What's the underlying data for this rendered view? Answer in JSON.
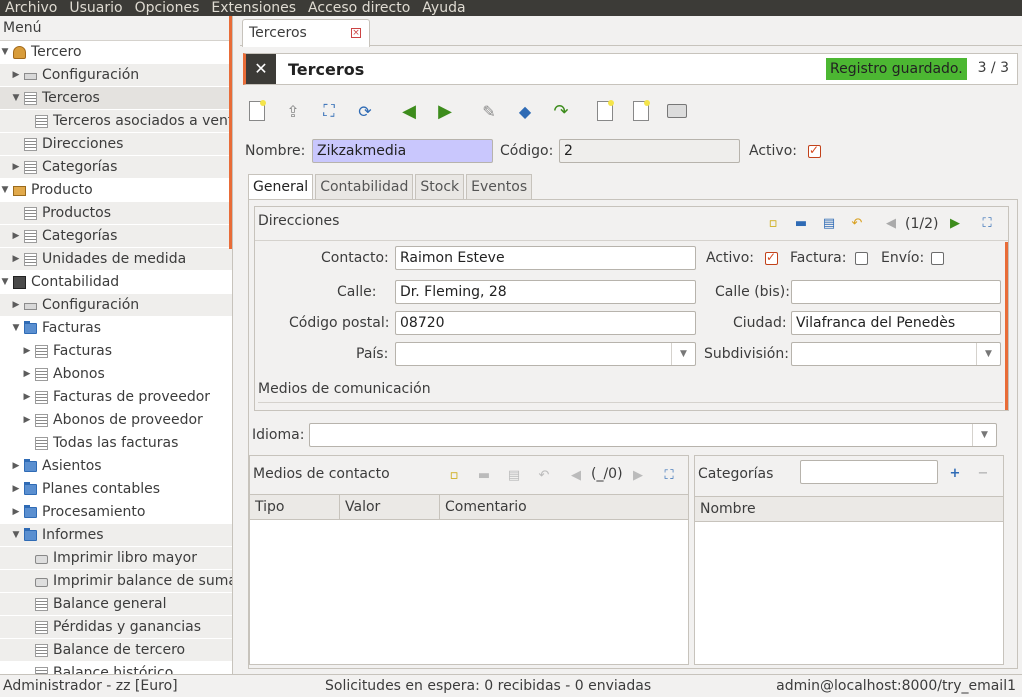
{
  "menubar": {
    "items": [
      "Archivo",
      "Usuario",
      "Opciones",
      "Extensiones",
      "Acceso directo",
      "Ayuda"
    ]
  },
  "sidebar": {
    "header": "Menú",
    "items": [
      {
        "label": "Tercero",
        "level": 0,
        "arrow": "open",
        "icon": "people-icon"
      },
      {
        "label": "Configuración",
        "level": 1,
        "arrow": "closed",
        "icon": "config-icon"
      },
      {
        "label": "Terceros",
        "level": 1,
        "arrow": "open",
        "icon": "document-icon",
        "selected": true
      },
      {
        "label": "Terceros asociados a venta",
        "level": 2,
        "arrow": "none",
        "icon": "document-icon"
      },
      {
        "label": "Direcciones",
        "level": 1,
        "arrow": "none",
        "icon": "document-icon"
      },
      {
        "label": "Categorías",
        "level": 1,
        "arrow": "closed",
        "icon": "document-icon"
      },
      {
        "label": "Producto",
        "level": 0,
        "arrow": "open",
        "icon": "box-icon"
      },
      {
        "label": "Productos",
        "level": 1,
        "arrow": "none",
        "icon": "document-icon"
      },
      {
        "label": "Categorías",
        "level": 1,
        "arrow": "closed",
        "icon": "document-icon"
      },
      {
        "label": "Unidades de medida",
        "level": 1,
        "arrow": "closed",
        "icon": "document-icon"
      },
      {
        "label": "Contabilidad",
        "level": 0,
        "arrow": "open",
        "icon": "calculator-icon"
      },
      {
        "label": "Configuración",
        "level": 1,
        "arrow": "closed",
        "icon": "config-icon"
      },
      {
        "label": "Facturas",
        "level": 1,
        "arrow": "open",
        "icon": "folder-icon"
      },
      {
        "label": "Facturas",
        "level": 2,
        "arrow": "closed",
        "icon": "document-icon"
      },
      {
        "label": "Abonos",
        "level": 2,
        "arrow": "closed",
        "icon": "document-icon"
      },
      {
        "label": "Facturas de proveedor",
        "level": 2,
        "arrow": "closed",
        "icon": "document-icon"
      },
      {
        "label": "Abonos de proveedor",
        "level": 2,
        "arrow": "closed",
        "icon": "document-icon"
      },
      {
        "label": "Todas las facturas",
        "level": 2,
        "arrow": "none",
        "icon": "document-icon"
      },
      {
        "label": "Asientos",
        "level": 1,
        "arrow": "closed",
        "icon": "folder-icon"
      },
      {
        "label": "Planes contables",
        "level": 1,
        "arrow": "closed",
        "icon": "folder-icon"
      },
      {
        "label": "Procesamiento",
        "level": 1,
        "arrow": "closed",
        "icon": "folder-icon"
      },
      {
        "label": "Informes",
        "level": 1,
        "arrow": "open",
        "icon": "folder-icon"
      },
      {
        "label": "Imprimir libro mayor",
        "level": 2,
        "arrow": "none",
        "icon": "printer-icon"
      },
      {
        "label": "Imprimir balance de sumas",
        "level": 2,
        "arrow": "none",
        "icon": "printer-icon"
      },
      {
        "label": "Balance general",
        "level": 2,
        "arrow": "none",
        "icon": "document-icon"
      },
      {
        "label": "Pérdidas y ganancias",
        "level": 2,
        "arrow": "none",
        "icon": "document-icon"
      },
      {
        "label": "Balance de tercero",
        "level": 2,
        "arrow": "none",
        "icon": "document-icon"
      },
      {
        "label": "Balance histórico",
        "level": 2,
        "arrow": "none",
        "icon": "document-icon"
      }
    ]
  },
  "tab": {
    "label": "Terceros"
  },
  "form": {
    "title": "Terceros",
    "status": "Registro guardado.",
    "record_pos": "3 / 3",
    "nombre_label": "Nombre:",
    "nombre_value": "Zikzakmedia",
    "codigo_label": "Código:",
    "codigo_value": "2",
    "activo_label": "Activo:"
  },
  "notebook": {
    "tabs": [
      "General",
      "Contabilidad",
      "Stock",
      "Eventos"
    ],
    "active": 0
  },
  "direcciones": {
    "header": "Direcciones",
    "pager": "(1/2)",
    "contacto_label": "Contacto:",
    "contacto_value": "Raimon Esteve",
    "activo_label": "Activo:",
    "factura_label": "Factura:",
    "envio_label": "Envío:",
    "calle_label": "Calle:",
    "calle_value": "Dr. Fleming, 28",
    "calle_bis_label": "Calle (bis):",
    "calle_bis_value": "",
    "cp_label": "Código postal:",
    "cp_value": "08720",
    "ciudad_label": "Ciudad:",
    "ciudad_value": "Vilafranca del Penedès",
    "pais_label": "País:",
    "pais_value": "",
    "subdivision_label": "Subdivisión:",
    "subdivision_value": "",
    "medios_label": "Medios de comunicación"
  },
  "idioma": {
    "label": "Idioma:",
    "value": ""
  },
  "medios_contacto": {
    "header": "Medios de contacto",
    "pager": "(_/0)",
    "columns": [
      "Tipo",
      "Valor",
      "Comentario"
    ]
  },
  "categorias": {
    "header": "Categorías",
    "search_value": "",
    "columns": [
      "Nombre"
    ]
  },
  "statusbar": {
    "left": "Administrador - zz [Euro]",
    "center": "Solicitudes en espera: 0 recibidas - 0 enviadas",
    "right": "admin@localhost:8000/try_email1"
  },
  "colors": {
    "accent": "#e86c38",
    "status_ok": "#4cb732",
    "required_bg": "#c9c7fd",
    "menubar_bg": "#3c3b37"
  }
}
